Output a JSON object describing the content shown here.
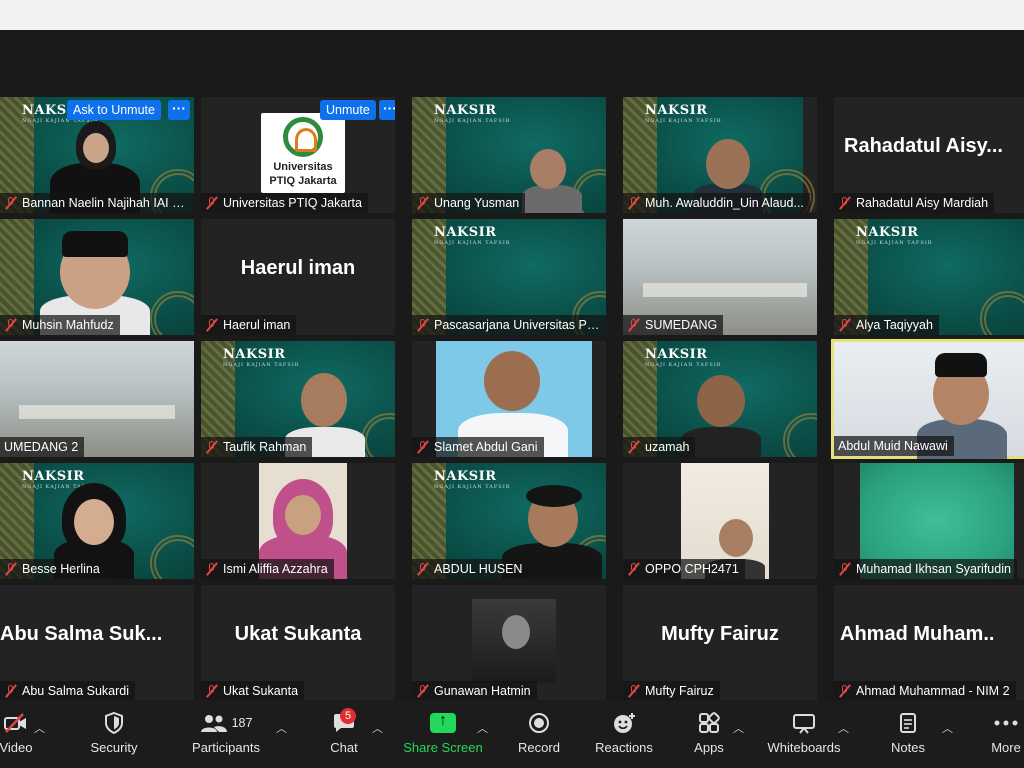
{
  "tiles": [
    {
      "name": "Bannan Naelin Najihah IAI P...",
      "bg": "teal",
      "naksir": true,
      "ask": "Ask to Unmute",
      "more": "···"
    },
    {
      "name": "Universitas PTIQ Jakarta",
      "bg": "dark",
      "logo": {
        "line1": "Universitas",
        "line2": "PTIQ Jakarta"
      },
      "ask": "Unmute",
      "more": "···"
    },
    {
      "name": "Unang Yusman",
      "bg": "teal",
      "naksir": true
    },
    {
      "name": "Muh. Awaluddin_Uin Alaud...",
      "bg": "teal",
      "naksir": true
    },
    {
      "name": "Rahadatul Aisy Mardiah",
      "bg": "dark",
      "big": "Rahadatul  Aisy..."
    },
    {
      "name": "Muhsin Mahfudz",
      "bg": "teal"
    },
    {
      "name": "Haerul iman",
      "bg": "dark",
      "big": "Haerul iman"
    },
    {
      "name": "Pascasarjana Universitas PTI...",
      "bg": "teal",
      "naksir": true
    },
    {
      "name": "SUMEDANG",
      "bg": "room"
    },
    {
      "name": "Alya Taqiyyah",
      "bg": "teal",
      "naksir": true
    },
    {
      "name": "UMEDANG 2",
      "bg": "room"
    },
    {
      "name": "Taufik Rahman",
      "bg": "teal",
      "naksir": true
    },
    {
      "name": "Slamet Abdul Gani",
      "bg": "light"
    },
    {
      "name": "uzamah",
      "bg": "teal",
      "naksir": true
    },
    {
      "name": "Abdul Muid Nawawi",
      "bg": "light",
      "active": true,
      "nomic": true
    },
    {
      "name": "Besse Herlina",
      "bg": "teal",
      "naksir": true
    },
    {
      "name": "Ismi Aliffia Azzahra",
      "bg": "light"
    },
    {
      "name": "ABDUL HUSEN",
      "bg": "teal",
      "naksir": true
    },
    {
      "name": "OPPO CPH2471",
      "bg": "wall"
    },
    {
      "name": "Muhamad Ikhsan Syarifudin",
      "bg": "green"
    },
    {
      "name": "Abu Salma Sukardi",
      "bg": "dark",
      "big": "Abu  Salma  Suk..."
    },
    {
      "name": "Ukat Sukanta",
      "bg": "dark",
      "big": "Ukat Sukanta"
    },
    {
      "name": "Gunawan Hatmin",
      "bg": "bw"
    },
    {
      "name": "Mufty Fairuz",
      "bg": "dark",
      "big": "Mufty Fairuz"
    },
    {
      "name": "Ahmad Muhammad - NIM 2",
      "bg": "dark",
      "big": "Ahmad  Muham.."
    }
  ],
  "naksir_text": "NAKSIR",
  "naksir_sub": "NGAJI KAJIAN TAFSIR",
  "toolbar": {
    "video": "Video",
    "security": "Security",
    "participants": "Participants",
    "participants_count": "187",
    "chat": "Chat",
    "chat_badge": "5",
    "share": "Share Screen",
    "record": "Record",
    "reactions": "Reactions",
    "apps": "Apps",
    "whiteboards": "Whiteboards",
    "notes": "Notes",
    "more": "More"
  },
  "colors": {
    "accent": "#0e71eb",
    "share": "#23d959",
    "muted": "#e04545",
    "active_border": "#e6e07a"
  }
}
